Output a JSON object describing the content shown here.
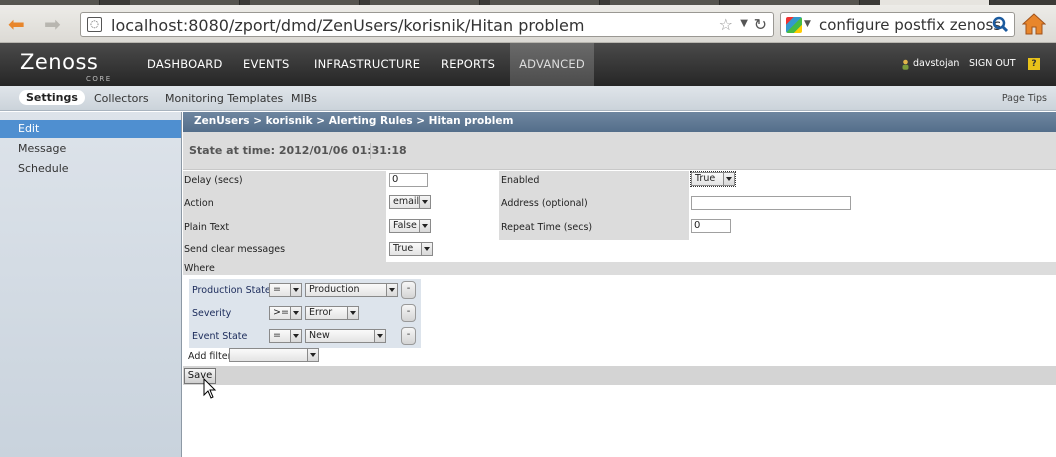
{
  "browser": {
    "url": "localhost:8080/zport/dmd/ZenUsers/korisnik/Hitan problem",
    "search_text": "configure postfix zenoss"
  },
  "header": {
    "logo_main": "Zenoss",
    "logo_sub": "CORE",
    "nav": {
      "dashboard": "DASHBOARD",
      "events": "EVENTS",
      "infrastructure": "INFRASTRUCTURE",
      "reports": "REPORTS",
      "advanced": "ADVANCED"
    },
    "user": "davstojan",
    "signout": "SIGN OUT",
    "help": "?"
  },
  "subnav": {
    "settings": "Settings",
    "collectors": "Collectors",
    "templates": "Monitoring Templates",
    "mibs": "MIBs",
    "page_tips": "Page Tips"
  },
  "sidebar": {
    "items": [
      "Edit",
      "Message",
      "Schedule"
    ]
  },
  "breadcrumb": "ZenUsers > korisnik > Alerting Rules > Hitan problem",
  "state": "State at time: 2012/01/06 01:31:18",
  "form": {
    "delay_label": "Delay (secs)",
    "delay_value": "0",
    "enabled_label": "Enabled",
    "enabled_value": "True",
    "action_label": "Action",
    "action_value": "email",
    "address_label": "Address (optional)",
    "address_value": "",
    "plaintext_label": "Plain Text",
    "plaintext_value": "False",
    "repeat_label": "Repeat Time (secs)",
    "repeat_value": "0",
    "clear_label": "Send clear messages",
    "clear_value": "True"
  },
  "where": {
    "label": "Where",
    "filters": [
      {
        "field": "Production State",
        "op": "=",
        "value": "Production",
        "remove": "-"
      },
      {
        "field": "Severity",
        "op": ">=",
        "value": "Error",
        "remove": "-"
      },
      {
        "field": "Event State",
        "op": "=",
        "value": "New",
        "remove": "-"
      }
    ],
    "add_filter_label": "Add filter",
    "add_filter_value": ""
  },
  "save_label": "Save"
}
